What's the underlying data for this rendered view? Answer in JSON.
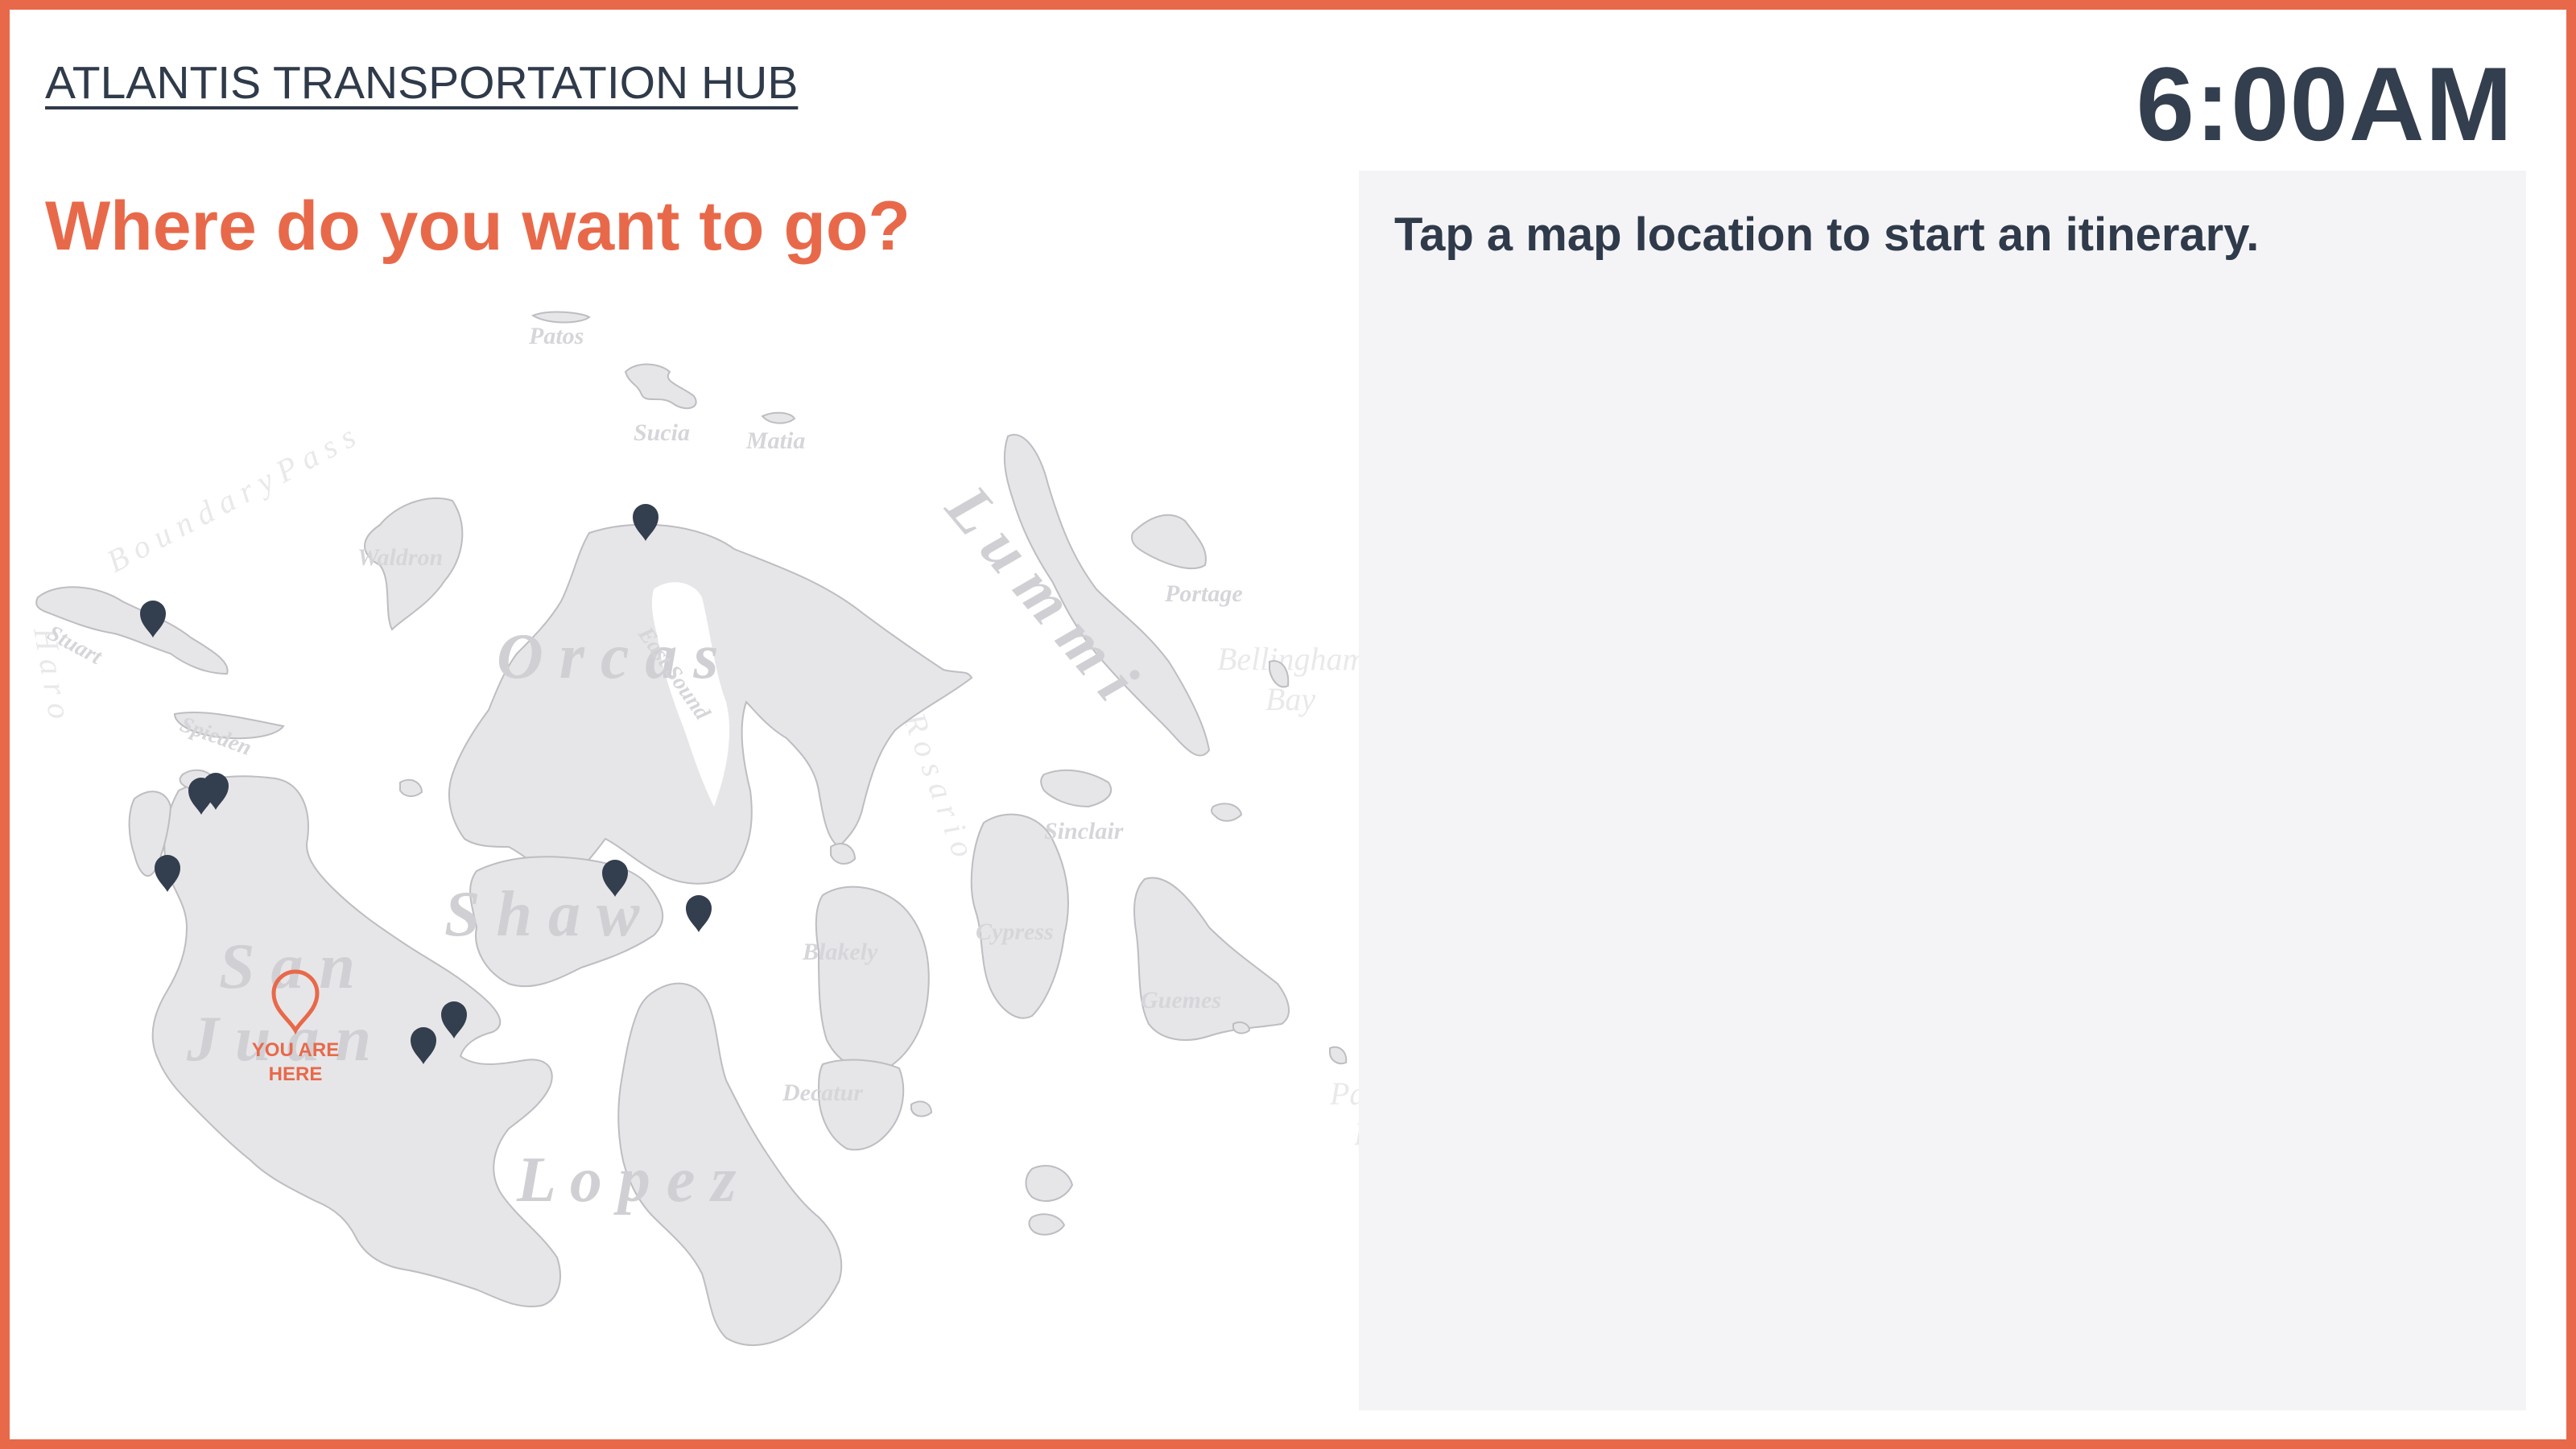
{
  "header": {
    "title": "ATLANTIS TRANSPORTATION HUB",
    "time": "6:00AM"
  },
  "main": {
    "question": "Where do you want to go?"
  },
  "map": {
    "you_are_here_line1": "YOU ARE",
    "you_are_here_line2": "HERE",
    "marker_icon": "location-pin-icon",
    "labels": {
      "patos": "Patos",
      "sucia": "Sucia",
      "matia": "Matia",
      "waldron": "Waldron",
      "stuart": "Stuart",
      "spieden": "Spieden",
      "orcas": "O r c a s",
      "shaw": "S h a w",
      "san": "S a n",
      "juan": "J u a n",
      "lopez": "L o p e z",
      "blakely": "Blakely",
      "decatur": "Decatur",
      "cypress": "Cypress",
      "guemes": "Guemes",
      "sinclair": "Sinclair",
      "lummi": "L u m m i",
      "portage": "Portage",
      "bellingham": "Bellingham",
      "bay": "Bay",
      "padilla": "Padilla",
      "padilla_bay": "Bay",
      "boundary_pass": "B o u n d a r y   P a s s",
      "east_sound": "East Sound",
      "rosario": "R o s a r i o",
      "haro": "H a r o"
    }
  },
  "panel": {
    "message": "Tap a map location to start an itinerary."
  },
  "colors": {
    "accent": "#E8694A",
    "text_dark": "#2F3A4A",
    "land": "#E6E6E8",
    "panel_bg": "#F4F4F6"
  }
}
